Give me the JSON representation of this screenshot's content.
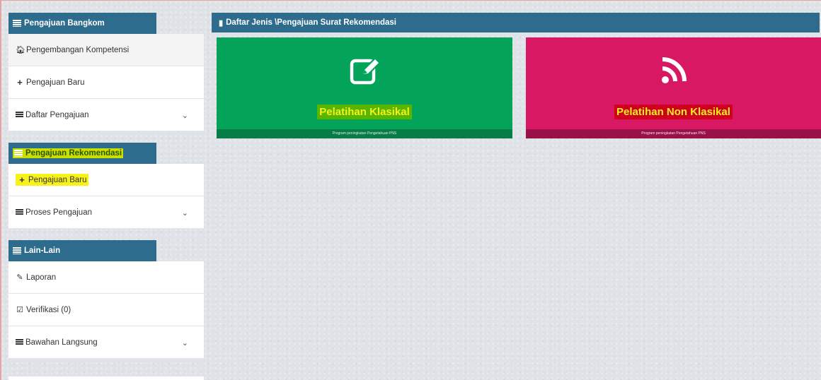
{
  "sidebar": {
    "sections": [
      {
        "title": "Pengajuan Bangkom",
        "items": [
          {
            "label": "Pengembangan Kompetensi",
            "icon": "home-icon"
          },
          {
            "label": "Pengajuan Baru",
            "icon": "plus-icon"
          },
          {
            "label": "Daftar Pengajuan",
            "icon": "list-icon",
            "chevron": true
          }
        ]
      },
      {
        "title": "Pengajuan Rekomendasi",
        "items": [
          {
            "label": "Pengajuan Baru",
            "icon": "plus-icon"
          },
          {
            "label": "Proses Pengajuan",
            "icon": "list-icon",
            "chevron": true
          }
        ]
      },
      {
        "title": "Lain-Lain",
        "items": [
          {
            "label": "Laporan",
            "icon": "edit-icon"
          },
          {
            "label": "Verifikasi (0)",
            "icon": "check-icon"
          },
          {
            "label": "Bawahan Langsung",
            "icon": "list-icon",
            "chevron": true
          }
        ]
      }
    ]
  },
  "main": {
    "header": "Daftar Jenis \\Pengajuan Surat Rekomendasi",
    "cards": [
      {
        "title": "Pelatihan Klasikal",
        "footer": "Program peningkatan Pengetahuan PNS",
        "color": "#04a35a",
        "icon": "edit-icon"
      },
      {
        "title": "Pelatihan Non Klasikal",
        "footer": "Program peningkatan Pengetahuan PNS",
        "color": "#d81862",
        "icon": "rss-icon"
      }
    ]
  },
  "colors": {
    "header": "#2e6c8e",
    "highlight_green": "#c8e000",
    "highlight_yellow": "#f6f21a"
  }
}
